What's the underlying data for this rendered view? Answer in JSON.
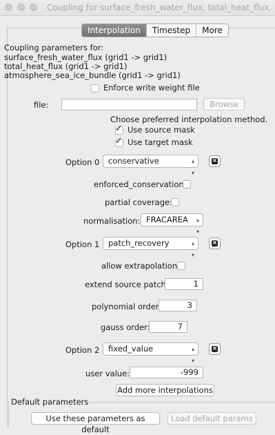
{
  "window": {
    "title": "Coupling for surface_fresh_water_flux, total_heat_flux, atmosphere_..."
  },
  "tabs": [
    {
      "label": "Interpolation",
      "active": true
    },
    {
      "label": "Timestep",
      "active": false
    },
    {
      "label": "More",
      "active": false
    }
  ],
  "params": {
    "header": "Coupling parameters for:",
    "lines": [
      "surface_fresh_water_flux (grid1 -> grid1)",
      "total_heat_flux (grid1 -> grid1)",
      "atmosphere_sea_ice_bundle (grid1 -> grid1)"
    ]
  },
  "enforce_write": {
    "label": "Enforce write weight file",
    "checked": false
  },
  "file": {
    "label": "file:",
    "value": "",
    "browse_label": "Browse"
  },
  "method": {
    "prompt": "Choose preferred interpolation method.",
    "use_source_mask": {
      "label": "Use source mask",
      "checked": true
    },
    "use_target_mask": {
      "label": "Use target mask",
      "checked": true
    }
  },
  "options": [
    {
      "label": "Option 0",
      "method": "conservative"
    },
    {
      "label": "Option 1",
      "method": "patch_recovery"
    },
    {
      "label": "Option 2",
      "method": "fixed_value"
    }
  ],
  "conservative": {
    "enforced_label": "enforced_conservation:",
    "enforced_checked": false,
    "partial_label": "partial coverage:",
    "partial_checked": false,
    "normalisation_label": "normalisation:",
    "normalisation_value": "FRACAREA"
  },
  "patch": {
    "allow_extrap_label": "allow extrapolation:",
    "allow_extrap_checked": false,
    "extend_label": "extend source patch:",
    "extend_value": "1",
    "poly_label": "polynomial order:",
    "poly_value": "3",
    "gauss_label": "gauss order:",
    "gauss_value": "7"
  },
  "fixed": {
    "user_value_label": "user value:",
    "user_value": "-999"
  },
  "add_more_label": "Add more interpolations",
  "defaults": {
    "group_label": "Default parameters",
    "use_label": "Use these parameters as default",
    "load_label": "Load default params"
  },
  "icons": {
    "remove": "remove-option-icon",
    "select": "select-arrows-icon",
    "check": "checkmark-icon"
  }
}
